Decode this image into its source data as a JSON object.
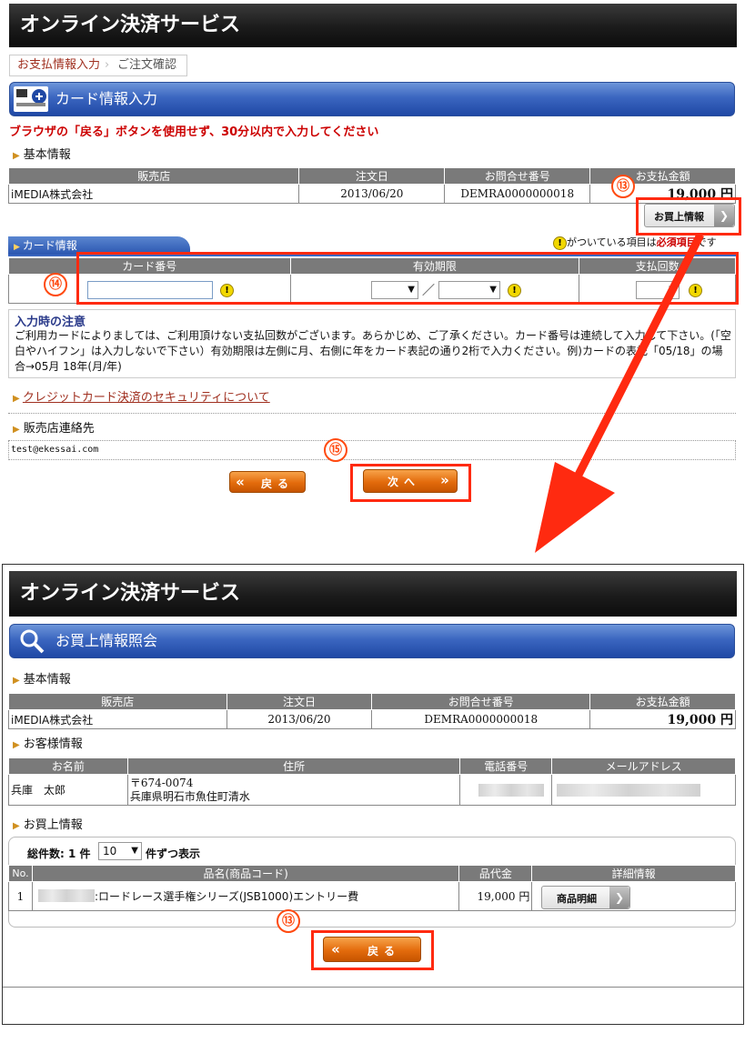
{
  "header": {
    "title": "オンライン決済サービス"
  },
  "breadcrumb": {
    "step1": "お支払情報入力",
    "step2": "ご注文確認"
  },
  "card_input": {
    "title": "カード情報入力"
  },
  "warning": "ブラウザの「戻る」ボタンを使用せず、30分以内で入力してください",
  "basic_info": {
    "label": "基本情報",
    "headers": [
      "販売店",
      "注文日",
      "お問合せ番号",
      "お支払金額"
    ],
    "row": [
      "iMEDIA株式会社",
      "2013/06/20",
      "DEMRA0000000018",
      "19,000 円"
    ]
  },
  "purchase_info_button": "お買上情報",
  "card_info": {
    "tab_label": "カード情報",
    "required_note_pre": "がついている項目は",
    "required_note_bold": "必須項目",
    "required_note_post": "です",
    "headers": [
      "カード番号",
      "有効期限",
      "支払回数"
    ],
    "slash": "／"
  },
  "notice": {
    "title": "入力時の注意",
    "body": "ご利用カードによりましては、ご利用頂けない支払回数がございます。あらかじめ、ご了承ください。カード番号は連続して入力して下さい。(「空白やハイフン」は入力しないで下さい）有効期限は左側に月、右側に年をカード表記の通り2桁で入力ください。例)カードの表記「05/18」の場合→05月 18年(月/年)"
  },
  "security_link": "クレジットカード決済のセキュリティについて",
  "shop_contact": {
    "label": "販売店連絡先",
    "email": "test@ekessai.com"
  },
  "buttons": {
    "back": "戻る",
    "next": "次へ"
  },
  "markers": {
    "m13": "⑬",
    "m14": "⑭",
    "m15": "⑮"
  },
  "lookup": {
    "header": "オンライン決済サービス",
    "title": "お買上情報照会",
    "basic_label": "基本情報",
    "basic_headers": [
      "販売店",
      "注文日",
      "お問合せ番号",
      "お支払金額"
    ],
    "basic_row": [
      "iMEDIA株式会社",
      "2013/06/20",
      "DEMRA0000000018",
      "19,000 円"
    ],
    "customer_label": "お客様情報",
    "customer_headers": [
      "お名前",
      "住所",
      "電話番号",
      "メールアドレス"
    ],
    "customer_name": "兵庫　太郎",
    "postal": "〒674-0074",
    "address": "兵庫県明石市魚住町清水",
    "purchase_label": "お買上情報",
    "total_label": "総件数: 1 件",
    "per_page": "10",
    "per_page_suffix": "件ずつ表示",
    "item_headers": [
      "No.",
      "品名(商品コード)",
      "品代金",
      "詳細情報"
    ],
    "item_no": "1",
    "item_name": ":ロードレース選手権シリーズ(JSB1000)エントリー費",
    "item_price": "19,000 円",
    "detail_button": "商品明細",
    "back_button": "戻る"
  },
  "colors": {
    "accent_red": "#ff2a10",
    "header_dark": "#1b1b1b",
    "title_blue": "#3b66c0",
    "button_orange": "#e36b0c",
    "warning_red": "#cc0000"
  }
}
